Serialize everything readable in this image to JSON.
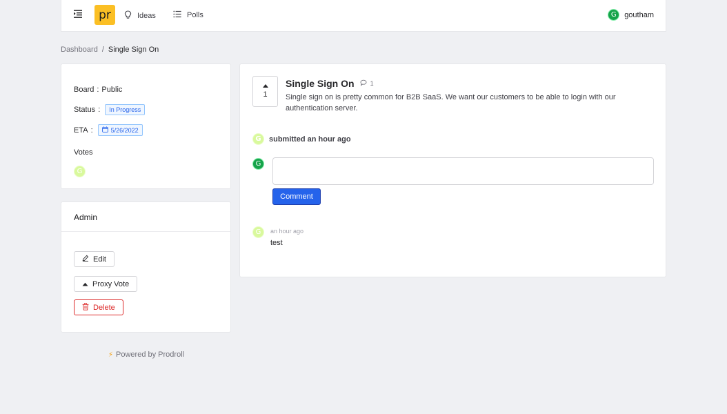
{
  "app": {
    "logo_text": "pr"
  },
  "nav": {
    "items": [
      {
        "label": "Ideas",
        "icon": "lightbulb-icon"
      },
      {
        "label": "Polls",
        "icon": "list-icon"
      }
    ],
    "user": {
      "name": "goutham",
      "initial": "G"
    }
  },
  "breadcrumb": {
    "parent": "Dashboard",
    "separator": "/",
    "current": "Single Sign On"
  },
  "info": {
    "board_label": "Board",
    "board_value": "Public",
    "status_label": "Status",
    "status_value": "In Progress",
    "eta_label": "ETA",
    "eta_value": "5/26/2022",
    "votes_label": "Votes",
    "voter_initial": "G"
  },
  "admin": {
    "title": "Admin",
    "edit_label": "Edit",
    "proxy_vote_label": "Proxy Vote",
    "delete_label": "Delete"
  },
  "footer": {
    "powered_by": "Powered by Prodroll"
  },
  "post": {
    "votes": "1",
    "title": "Single Sign On",
    "comment_count": "1",
    "description": "Single sign on is pretty common for B2B SaaS. We want our customers to be able to login with our authentication server.",
    "submitted_initial": "G",
    "submitted_text": "submitted an hour ago"
  },
  "comment_form": {
    "user_initial": "G",
    "input_value": "",
    "button_label": "Comment"
  },
  "comments": [
    {
      "initial": "G",
      "time": "an hour ago",
      "text": "test"
    }
  ],
  "colors": {
    "accent": "#2563eb",
    "logo_bg": "#fbbf24",
    "danger": "#dc2626",
    "user_avatar": "#16a34a",
    "voter_avatar": "#d9f99d",
    "background": "#eff0f3"
  }
}
